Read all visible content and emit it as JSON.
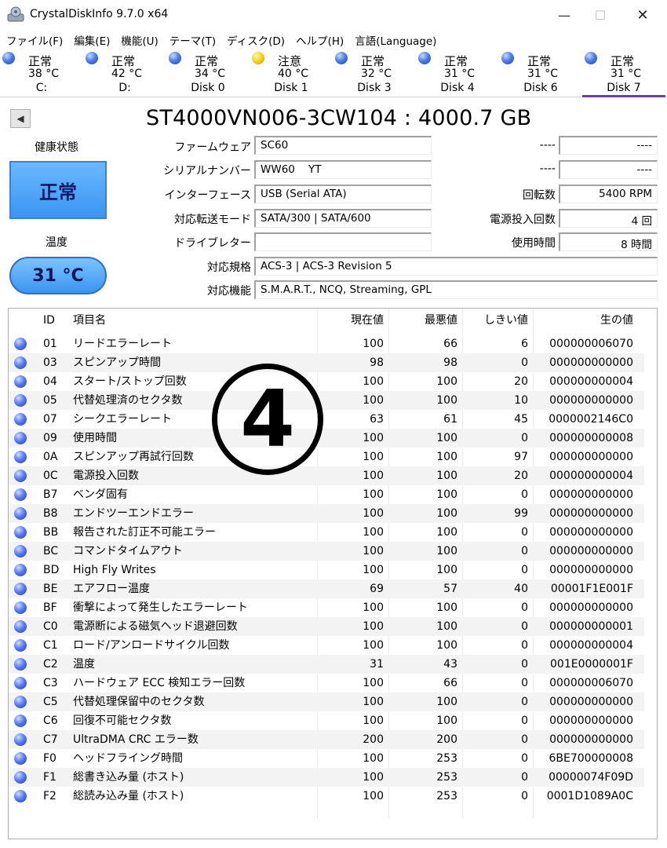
{
  "window": {
    "title": "CrystalDiskInfo 9.7.0 x64",
    "minimize": "—",
    "maximize": "☐",
    "close": "✕"
  },
  "menu": [
    "ファイル(F)",
    "編集(E)",
    "機能(U)",
    "テーマ(T)",
    "ディスク(D)",
    "ヘルプ(H)",
    "言語(Language)"
  ],
  "disks": [
    {
      "status": "正常",
      "temp": "38 °C",
      "name": "C:",
      "color": "blue"
    },
    {
      "status": "正常",
      "temp": "42 °C",
      "name": "D:",
      "color": "blue"
    },
    {
      "status": "正常",
      "temp": "34 °C",
      "name": "Disk 0",
      "color": "blue"
    },
    {
      "status": "注意",
      "temp": "40 °C",
      "name": "Disk 1",
      "color": "yellow"
    },
    {
      "status": "正常",
      "temp": "32 °C",
      "name": "Disk 3",
      "color": "blue"
    },
    {
      "status": "正常",
      "temp": "31 °C",
      "name": "Disk 4",
      "color": "blue"
    },
    {
      "status": "正常",
      "temp": "31 °C",
      "name": "Disk 6",
      "color": "blue"
    },
    {
      "status": "正常",
      "temp": "31 °C",
      "name": "Disk 7",
      "color": "blue",
      "selected": true
    }
  ],
  "model": "ST4000VN006-3CW104 : 4000.7 GB",
  "health": {
    "label": "健康状態",
    "value": "正常",
    "color": "#4aa3f7"
  },
  "temperature": {
    "label": "温度",
    "value": "31 °C"
  },
  "info": {
    "firmware_label": "ファームウェア",
    "firmware": "SC60",
    "serial_label": "シリアルナンバー",
    "serial": "WW60    YT",
    "interface_label": "インターフェース",
    "interface": "USB (Serial ATA)",
    "transfer_label": "対応転送モード",
    "transfer": "SATA/300 | SATA/600",
    "drive_letter_label": "ドライブレター",
    "drive_letter": "",
    "standard_label": "対応規格",
    "standard": "ACS-3 | ACS-3 Revision 5",
    "features_label": "対応機能",
    "features": "S.M.A.R.T., NCQ, Streaming, GPL",
    "blank1_label": "----",
    "blank1": "----",
    "blank2_label": "----",
    "blank2": "----",
    "rotation_label": "回転数",
    "rotation": "5400 RPM",
    "power_count_label": "電源投入回数",
    "power_count": "4 回",
    "power_hours_label": "使用時間",
    "power_hours": "8 時間"
  },
  "smart": {
    "headers": {
      "id": "ID",
      "name": "項目名",
      "current": "現在値",
      "worst": "最悪値",
      "threshold": "しきい値",
      "raw": "生の値"
    },
    "rows": [
      {
        "id": "01",
        "name": "リードエラーレート",
        "current": "100",
        "worst": "66",
        "threshold": "6",
        "raw": "000000006070"
      },
      {
        "id": "03",
        "name": "スピンアップ時間",
        "current": "98",
        "worst": "98",
        "threshold": "0",
        "raw": "000000000000"
      },
      {
        "id": "04",
        "name": "スタート/ストップ回数",
        "current": "100",
        "worst": "100",
        "threshold": "20",
        "raw": "000000000004"
      },
      {
        "id": "05",
        "name": "代替処理済のセクタ数",
        "current": "100",
        "worst": "100",
        "threshold": "10",
        "raw": "000000000000"
      },
      {
        "id": "07",
        "name": "シークエラーレート",
        "current": "63",
        "worst": "61",
        "threshold": "45",
        "raw": "0000002146C0"
      },
      {
        "id": "09",
        "name": "使用時間",
        "current": "100",
        "worst": "100",
        "threshold": "0",
        "raw": "000000000008"
      },
      {
        "id": "0A",
        "name": "スピンアップ再試行回数",
        "current": "100",
        "worst": "100",
        "threshold": "97",
        "raw": "000000000000"
      },
      {
        "id": "0C",
        "name": "電源投入回数",
        "current": "100",
        "worst": "100",
        "threshold": "20",
        "raw": "000000000004"
      },
      {
        "id": "B7",
        "name": "ベンダ固有",
        "current": "100",
        "worst": "100",
        "threshold": "0",
        "raw": "000000000000"
      },
      {
        "id": "B8",
        "name": "エンドツーエンドエラー",
        "current": "100",
        "worst": "100",
        "threshold": "99",
        "raw": "000000000000"
      },
      {
        "id": "BB",
        "name": "報告された訂正不可能エラー",
        "current": "100",
        "worst": "100",
        "threshold": "0",
        "raw": "000000000000"
      },
      {
        "id": "BC",
        "name": "コマンドタイムアウト",
        "current": "100",
        "worst": "100",
        "threshold": "0",
        "raw": "000000000000"
      },
      {
        "id": "BD",
        "name": "High Fly Writes",
        "current": "100",
        "worst": "100",
        "threshold": "0",
        "raw": "000000000000"
      },
      {
        "id": "BE",
        "name": "エアフロー温度",
        "current": "69",
        "worst": "57",
        "threshold": "40",
        "raw": "00001F1E001F"
      },
      {
        "id": "BF",
        "name": "衝撃によって発生したエラーレート",
        "current": "100",
        "worst": "100",
        "threshold": "0",
        "raw": "000000000000"
      },
      {
        "id": "C0",
        "name": "電源断による磁気ヘッド退避回数",
        "current": "100",
        "worst": "100",
        "threshold": "0",
        "raw": "000000000001"
      },
      {
        "id": "C1",
        "name": "ロード/アンロードサイクル回数",
        "current": "100",
        "worst": "100",
        "threshold": "0",
        "raw": "000000000004"
      },
      {
        "id": "C2",
        "name": "温度",
        "current": "31",
        "worst": "43",
        "threshold": "0",
        "raw": "001E0000001F"
      },
      {
        "id": "C3",
        "name": "ハードウェア ECC 検知エラー回数",
        "current": "100",
        "worst": "66",
        "threshold": "0",
        "raw": "000000006070"
      },
      {
        "id": "C5",
        "name": "代替処理保留中のセクタ数",
        "current": "100",
        "worst": "100",
        "threshold": "0",
        "raw": "000000000000"
      },
      {
        "id": "C6",
        "name": "回復不可能セクタ数",
        "current": "100",
        "worst": "100",
        "threshold": "0",
        "raw": "000000000000"
      },
      {
        "id": "C7",
        "name": "UltraDMA CRC エラー数",
        "current": "200",
        "worst": "200",
        "threshold": "0",
        "raw": "000000000000"
      },
      {
        "id": "F0",
        "name": "ヘッドフライング時間",
        "current": "100",
        "worst": "253",
        "threshold": "0",
        "raw": "6BE700000008"
      },
      {
        "id": "F1",
        "name": "総書き込み量 (ホスト)",
        "current": "100",
        "worst": "253",
        "threshold": "0",
        "raw": "00000074F09D"
      },
      {
        "id": "F2",
        "name": "総読み込み量 (ホスト)",
        "current": "100",
        "worst": "253",
        "threshold": "0",
        "raw": "0001D1089A0C"
      }
    ]
  },
  "overlay_mark": "4"
}
